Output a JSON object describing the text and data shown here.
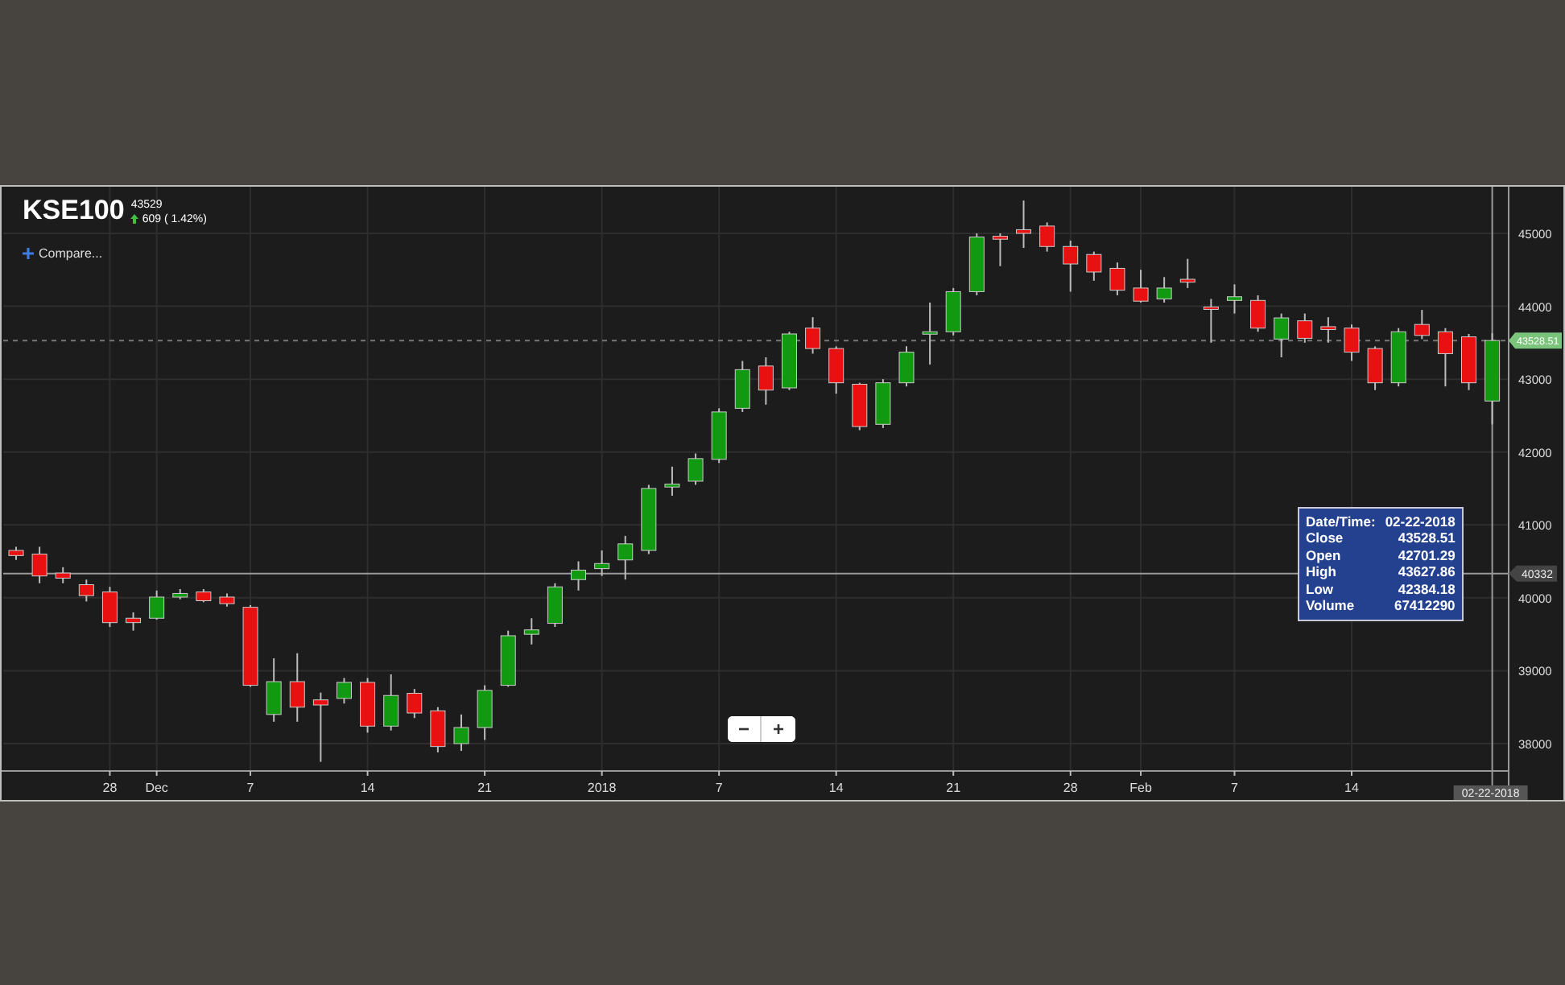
{
  "header": {
    "symbol": "KSE100",
    "price": "43529",
    "change": "609 ( 1.42%)",
    "rising": true,
    "compare_link": "Compare..."
  },
  "chart": {
    "chart_data": {
      "type": "candlestick",
      "categories": [
        null,
        null,
        null,
        null,
        "28",
        null,
        "Dec",
        null,
        null,
        null,
        "7",
        null,
        null,
        null,
        null,
        "14",
        null,
        null,
        null,
        null,
        "21",
        null,
        null,
        null,
        null,
        "2018",
        null,
        null,
        null,
        null,
        "7",
        null,
        null,
        null,
        null,
        "14",
        null,
        null,
        null,
        null,
        "21",
        null,
        null,
        null,
        null,
        "28",
        null,
        null,
        "Feb",
        null,
        null,
        null,
        "7",
        null,
        null,
        null,
        null,
        "14",
        null,
        null,
        null,
        null,
        null,
        null
      ],
      "ohlc": [
        [
          40650,
          40700,
          40520,
          40580
        ],
        [
          40600,
          40700,
          40200,
          40300
        ],
        [
          40340,
          40420,
          40200,
          40270
        ],
        [
          40180,
          40250,
          39950,
          40030
        ],
        [
          40080,
          40150,
          39600,
          39660
        ],
        [
          39720,
          39800,
          39550,
          39660
        ],
        [
          39720,
          40100,
          39700,
          40010
        ],
        [
          40010,
          40120,
          39980,
          40060
        ],
        [
          40080,
          40120,
          39940,
          39960
        ],
        [
          40010,
          40060,
          39880,
          39920
        ],
        [
          39870,
          39900,
          38780,
          38800
        ],
        [
          38400,
          39170,
          38300,
          38850
        ],
        [
          38850,
          39240,
          38300,
          38500
        ],
        [
          38600,
          38700,
          37750,
          38530
        ],
        [
          38620,
          38900,
          38550,
          38840
        ],
        [
          38840,
          38900,
          38150,
          38240
        ],
        [
          38240,
          38950,
          38180,
          38660
        ],
        [
          38690,
          38750,
          38350,
          38420
        ],
        [
          38450,
          38500,
          37880,
          37960
        ],
        [
          38000,
          38400,
          37900,
          38220
        ],
        [
          38220,
          38800,
          38050,
          38730
        ],
        [
          38800,
          39550,
          38780,
          39480
        ],
        [
          39500,
          39720,
          39360,
          39560
        ],
        [
          39650,
          40200,
          39600,
          40150
        ],
        [
          40250,
          40500,
          40100,
          40380
        ],
        [
          40400,
          40650,
          40300,
          40470
        ],
        [
          40520,
          40850,
          40250,
          40740
        ],
        [
          40650,
          41550,
          40600,
          41500
        ],
        [
          41520,
          41800,
          41400,
          41560
        ],
        [
          41600,
          41980,
          41550,
          41910
        ],
        [
          41900,
          42600,
          41850,
          42550
        ],
        [
          42600,
          43250,
          42550,
          43130
        ],
        [
          43180,
          43300,
          42650,
          42850
        ],
        [
          42880,
          43650,
          42850,
          43620
        ],
        [
          43700,
          43850,
          43350,
          43420
        ],
        [
          43420,
          43450,
          42800,
          42950
        ],
        [
          42930,
          42950,
          42300,
          42350
        ],
        [
          42380,
          43000,
          42330,
          42950
        ],
        [
          42950,
          43450,
          42900,
          43370
        ],
        [
          43620,
          44050,
          43200,
          43650
        ],
        [
          43650,
          44250,
          43600,
          44200
        ],
        [
          44200,
          45000,
          44150,
          44950
        ],
        [
          44960,
          45000,
          44550,
          44920
        ],
        [
          45050,
          45450,
          44800,
          45000
        ],
        [
          45100,
          45150,
          44750,
          44820
        ],
        [
          44820,
          44900,
          44200,
          44580
        ],
        [
          44710,
          44750,
          44350,
          44470
        ],
        [
          44520,
          44600,
          44150,
          44220
        ],
        [
          44250,
          44500,
          44050,
          44070
        ],
        [
          44100,
          44400,
          44050,
          44250
        ],
        [
          44370,
          44650,
          44250,
          44330
        ],
        [
          43990,
          44100,
          43500,
          43960
        ],
        [
          44080,
          44300,
          43900,
          44130
        ],
        [
          44080,
          44150,
          43650,
          43700
        ],
        [
          43550,
          43900,
          43300,
          43840
        ],
        [
          43800,
          43900,
          43500,
          43560
        ],
        [
          43720,
          43850,
          43500,
          43680
        ],
        [
          43700,
          43750,
          43250,
          43370
        ],
        [
          43420,
          43450,
          42850,
          42950
        ],
        [
          42950,
          43700,
          42900,
          43650
        ],
        [
          43750,
          43950,
          43550,
          43600
        ],
        [
          43650,
          43700,
          42900,
          43350
        ],
        [
          43580,
          43620,
          42850,
          42950
        ],
        [
          42700,
          43630,
          42380,
          43530
        ]
      ],
      "yticks": [
        38000,
        39000,
        40000,
        41000,
        42000,
        43000,
        44000,
        45000
      ],
      "grid": true,
      "ref_lines": [
        {
          "axis": "y",
          "value": 43528.51,
          "label": "43528.51"
        },
        {
          "axis": "y",
          "value": 40332,
          "label": "40332"
        }
      ],
      "ylim": [
        37625,
        45640
      ]
    },
    "crosshair": {
      "date_label": "02-22-2018"
    },
    "tooltip": [
      {
        "label": "Date/Time:",
        "value": "02-22-2018"
      },
      {
        "label": "Close",
        "value": "43528.51"
      },
      {
        "label": "Open",
        "value": "42701.29"
      },
      {
        "label": "High",
        "value": "43627.86"
      },
      {
        "label": "Low",
        "value": "42384.18"
      },
      {
        "label": "Volume",
        "value": "67412290"
      }
    ],
    "zoom_buttons": [
      {
        "kind": "out",
        "label": "−"
      },
      {
        "kind": "in",
        "label": "+"
      }
    ]
  }
}
